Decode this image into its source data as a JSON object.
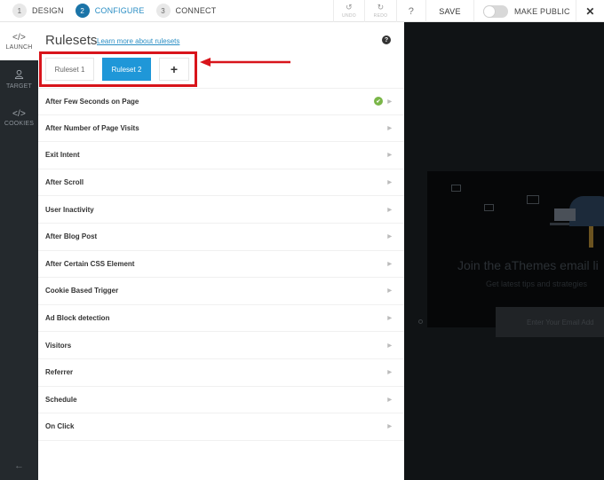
{
  "steps": [
    {
      "num": "1",
      "label": "DESIGN"
    },
    {
      "num": "2",
      "label": "CONFIGURE",
      "active": true
    },
    {
      "num": "3",
      "label": "CONNECT"
    }
  ],
  "toolbar": {
    "undo_label": "UNDO",
    "redo_label": "REDO",
    "help_label": "?",
    "save_label": "SAVE",
    "make_public_label": "MAKE PUBLIC",
    "make_public_on": false,
    "close_label": "✕"
  },
  "sidebar": {
    "items": [
      {
        "icon": "</>",
        "label": "LAUNCH",
        "active": true
      },
      {
        "icon": "👤",
        "label": "TARGET"
      },
      {
        "icon": "</>",
        "label": "COOKIES"
      }
    ],
    "back_icon": "←"
  },
  "panel": {
    "title": "Rulesets",
    "learn_link": "Learn more about rulesets",
    "help_icon": "?",
    "tabs": [
      {
        "label": "Ruleset 1"
      },
      {
        "label": "Ruleset 2",
        "active": true
      }
    ],
    "add_tab_label": "+",
    "rules": [
      {
        "label": "After Few Seconds on Page",
        "enabled": true
      },
      {
        "label": "After Number of Page Visits"
      },
      {
        "label": "Exit Intent"
      },
      {
        "label": "After Scroll"
      },
      {
        "label": "User Inactivity"
      },
      {
        "label": "After Blog Post"
      },
      {
        "label": "After Certain CSS Element"
      },
      {
        "label": "Cookie Based Trigger"
      },
      {
        "label": "Ad Block detection"
      },
      {
        "label": "Visitors"
      },
      {
        "label": "Referrer"
      },
      {
        "label": "Schedule"
      },
      {
        "label": "On Click"
      }
    ],
    "caret": "▶",
    "check": "✔"
  },
  "preview": {
    "title": "Join the aThemes email li",
    "subtitle": "Get latest tips and strategies",
    "email_placeholder": "Enter Your Email Add"
  },
  "colors": {
    "accent": "#1f97d8",
    "step_active": "#1b74a8",
    "annotation_red": "#d8141b",
    "check_green": "#7ab648",
    "sidebar_bg": "#24292d"
  }
}
